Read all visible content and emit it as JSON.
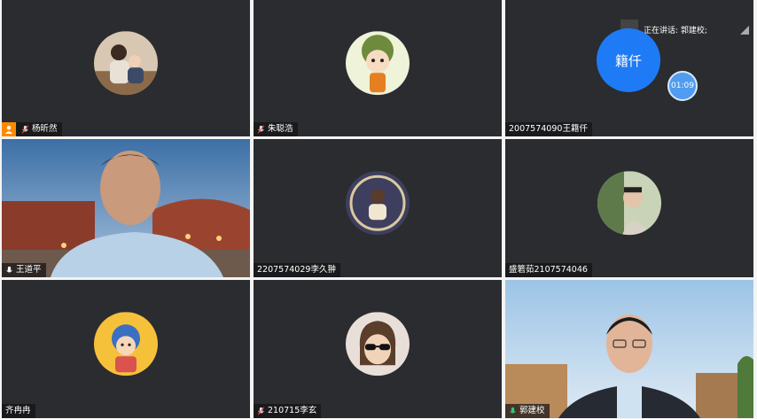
{
  "active_speaker": {
    "label": "正在讲话: 郭建校;"
  },
  "timer": "01:09",
  "tiles": [
    {
      "name": "杨昕然"
    },
    {
      "name": "朱聪浩"
    },
    {
      "name": "2007574090王籍仟",
      "avatar_text": "籍仟"
    },
    {
      "name": "王道平"
    },
    {
      "name": "2207574029李久翀"
    },
    {
      "name": "盛箬茹2107574046"
    },
    {
      "name": "齐冉冉"
    },
    {
      "name": "210715李玄"
    },
    {
      "name": "郭建校"
    }
  ],
  "colors": {
    "tile_bg": "#2b2c30",
    "blue_avatar": "#1e7bf5",
    "host_badge": "#ff8a00",
    "active_mic": "#2ecc71"
  }
}
